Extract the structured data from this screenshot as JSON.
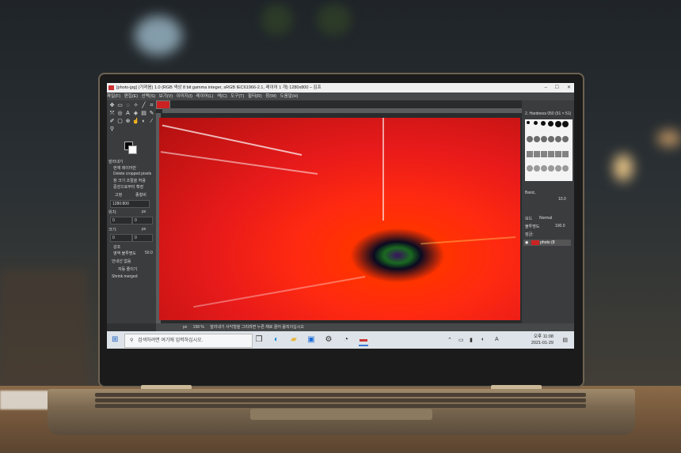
{
  "window": {
    "title": "[photo-jpg] (가져옴) 1.0 (RGB 색상 8 bit gamma integer, sRGB IEC61966-2.1, 레이어 1 개) 1280x800 – 김프",
    "controls": [
      "–",
      "☐",
      "✕"
    ]
  },
  "menu": [
    "파일(F)",
    "편집(E)",
    "선택(S)",
    "보기(V)",
    "이미지(I)",
    "레이어(L)",
    "색(C)",
    "도구(T)",
    "필터(R)",
    "창(W)",
    "도움말(H)"
  ],
  "tool_options": {
    "title": "잘라내기",
    "items": [
      "현재 레이어만",
      "Delete cropped pixels",
      "창 크기 조절을 허용",
      "중앙으로부터 확장"
    ],
    "fixed_label": "고정",
    "fixed_value": "종횡비",
    "ratio": "1280:800",
    "position_label": "위치:",
    "position_unit": "px",
    "position_x": "0",
    "position_y": "0",
    "size_label": "크기:",
    "size_unit": "px",
    "size_x": "0",
    "size_y": "0",
    "highlight_label": "강조",
    "shade_label": "영역 불투명도",
    "shade_value": "50.0",
    "guides": "안내선 없음",
    "auto_shrink": "자동 줄이기",
    "shrink_merged": "Shrink merged"
  },
  "statusbar": {
    "unit": "px",
    "zoom": "158 %",
    "message": "잘라내기 사각형을 그리려면 누른 채로 끌어 움직이십시오"
  },
  "dock": {
    "brush_name": "2. Hardness 050 (51 × 51)",
    "preset": "Basic,",
    "spacing": "10.0",
    "mode_label": "모드",
    "mode": "Normal",
    "opacity_label": "불투명도",
    "opacity": "100.0",
    "lock_label": "잠금:",
    "layer_name": "photo (8"
  },
  "taskbar": {
    "search_placeholder": "검색하려면 여기에 입력하십시오.",
    "time": "오후 11:08",
    "date": "2021-01-29",
    "ime": "A"
  }
}
